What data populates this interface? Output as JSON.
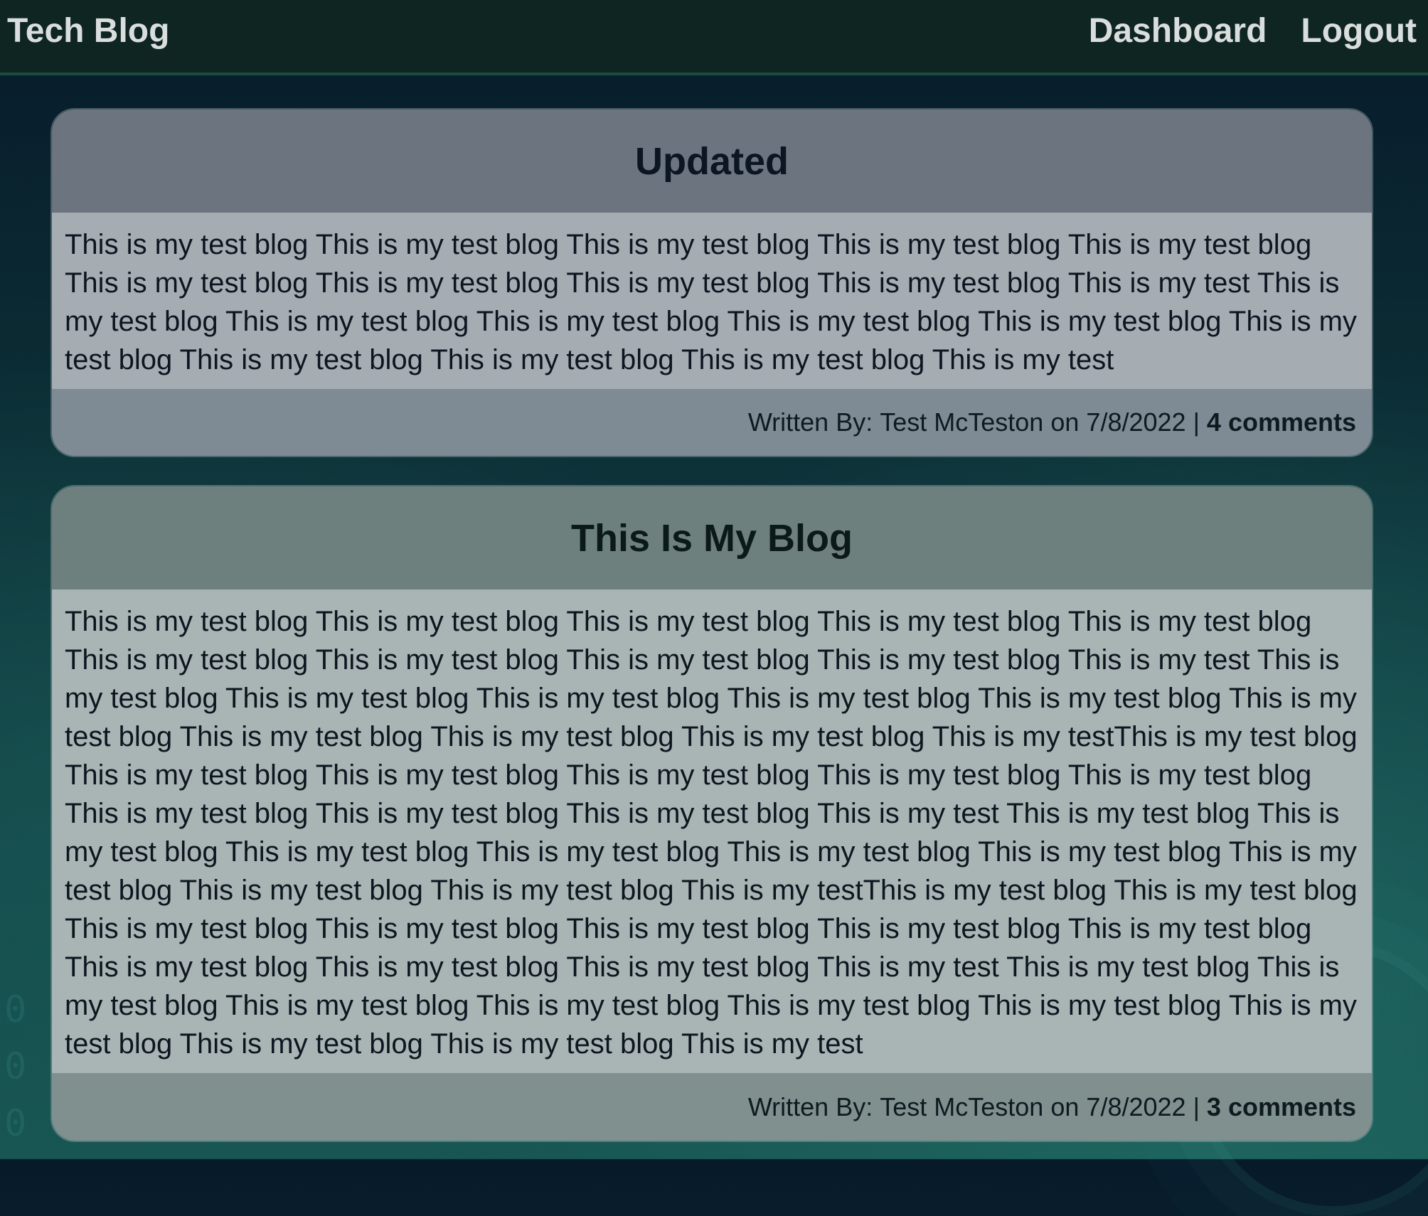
{
  "nav": {
    "brand": "Tech Blog",
    "links": [
      "Dashboard",
      "Logout"
    ]
  },
  "posts": [
    {
      "title": "Updated",
      "body": "This is my test blog This is my test blog This is my test blog This is my test blog This is my test blog This is my test blog This is my test blog This is my test blog This is my test blog This is my test This is my test blog This is my test blog This is my test blog This is my test blog This is my test blog This is my test blog This is my test blog This is my test blog This is my test blog This is my test",
      "author_prefix": "Written By:",
      "author": "Test McTeston",
      "date_prefix": "on",
      "date": "7/8/2022",
      "separator": "|",
      "comments": "4 comments"
    },
    {
      "title": "This Is My Blog",
      "body": "This is my test blog This is my test blog This is my test blog This is my test blog This is my test blog This is my test blog This is my test blog This is my test blog This is my test blog This is my test This is my test blog This is my test blog This is my test blog This is my test blog This is my test blog This is my test blog This is my test blog This is my test blog This is my test blog This is my testThis is my test blog This is my test blog This is my test blog This is my test blog This is my test blog This is my test blog This is my test blog This is my test blog This is my test blog This is my test This is my test blog This is my test blog This is my test blog This is my test blog This is my test blog This is my test blog This is my test blog This is my test blog This is my test blog This is my testThis is my test blog This is my test blog This is my test blog This is my test blog This is my test blog This is my test blog This is my test blog This is my test blog This is my test blog This is my test blog This is my test This is my test blog This is my test blog This is my test blog This is my test blog This is my test blog This is my test blog This is my test blog This is my test blog This is my test blog This is my test",
      "author_prefix": "Written By:",
      "author": "Test McTeston",
      "date_prefix": "on",
      "date": "7/8/2022",
      "separator": "|",
      "comments": "3 comments"
    }
  ]
}
